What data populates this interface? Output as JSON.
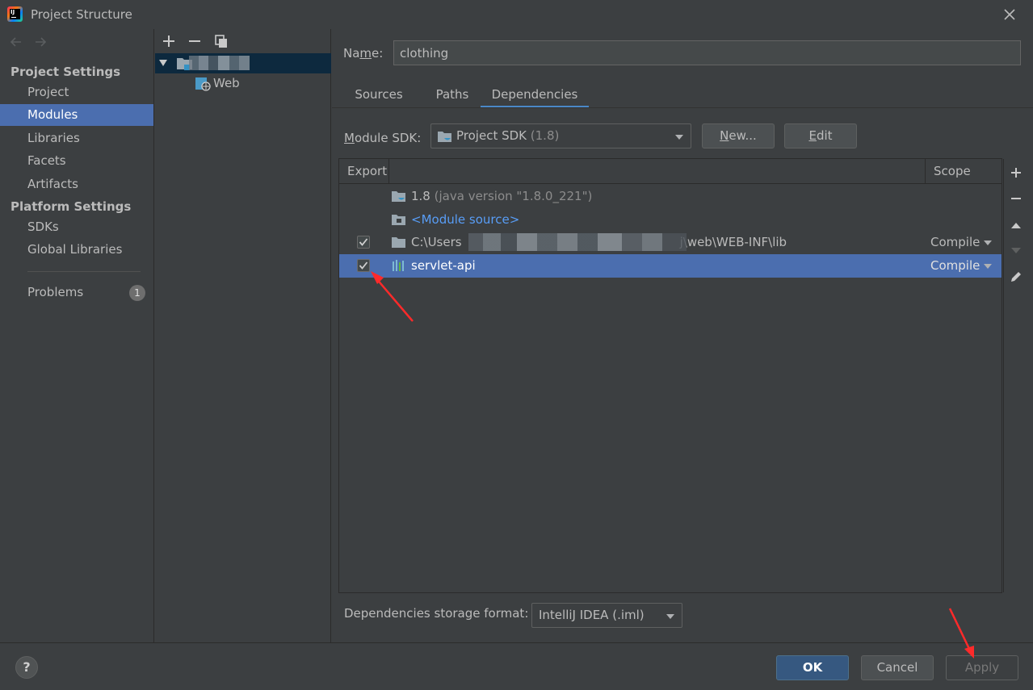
{
  "window": {
    "title": "Project Structure"
  },
  "sidebar": {
    "project_settings_title": "Project Settings",
    "project_items": [
      "Project",
      "Modules",
      "Libraries",
      "Facets",
      "Artifacts"
    ],
    "platform_settings_title": "Platform Settings",
    "platform_items": [
      "SDKs",
      "Global Libraries"
    ],
    "problems_label": "Problems",
    "problems_count": "1",
    "active_item": "Modules"
  },
  "tree": {
    "child_label": "Web"
  },
  "module": {
    "name_label_pre": "Na",
    "name_label_mn": "m",
    "name_label_post": "e:",
    "name_value": "clothing"
  },
  "tabs": [
    "Sources",
    "Paths",
    "Dependencies"
  ],
  "active_tab": "Dependencies",
  "sdk": {
    "label_u": "M",
    "label_rest": "odule SDK:",
    "value": "Project SDK",
    "value_dim": "(1.8)",
    "new_button_u": "N",
    "new_button_rest": "ew...",
    "edit_button_u": "E",
    "edit_button_rest": "dit"
  },
  "dependencies_table": {
    "col_export": "Export",
    "col_scope": "Scope",
    "rows": [
      {
        "text": "1.8",
        "dim": "(java version \"1.8.0_221\")",
        "checked": false,
        "scope": ""
      },
      {
        "text": "<Module source>",
        "dim": "",
        "checked": false,
        "scope": ""
      },
      {
        "text_prefix": "C:\\Users",
        "text_suffix": "j\\web\\WEB-INF\\lib",
        "checked": true,
        "scope": "Compile"
      },
      {
        "text": "servlet-api",
        "dim": "",
        "checked": true,
        "scope": "Compile",
        "selected": true
      }
    ]
  },
  "storage": {
    "label": "Dependencies storage format:",
    "value": "IntelliJ IDEA (.iml)"
  },
  "footer": {
    "help": "?",
    "ok": "OK",
    "cancel": "Cancel",
    "apply": "Apply"
  },
  "colors": {
    "background": "#3c3f41",
    "selection": "#4b6eaf",
    "tree_selection": "#0d293e",
    "link": "#589df6",
    "ok_button": "#365880",
    "annotation": "#ff2a2a"
  }
}
